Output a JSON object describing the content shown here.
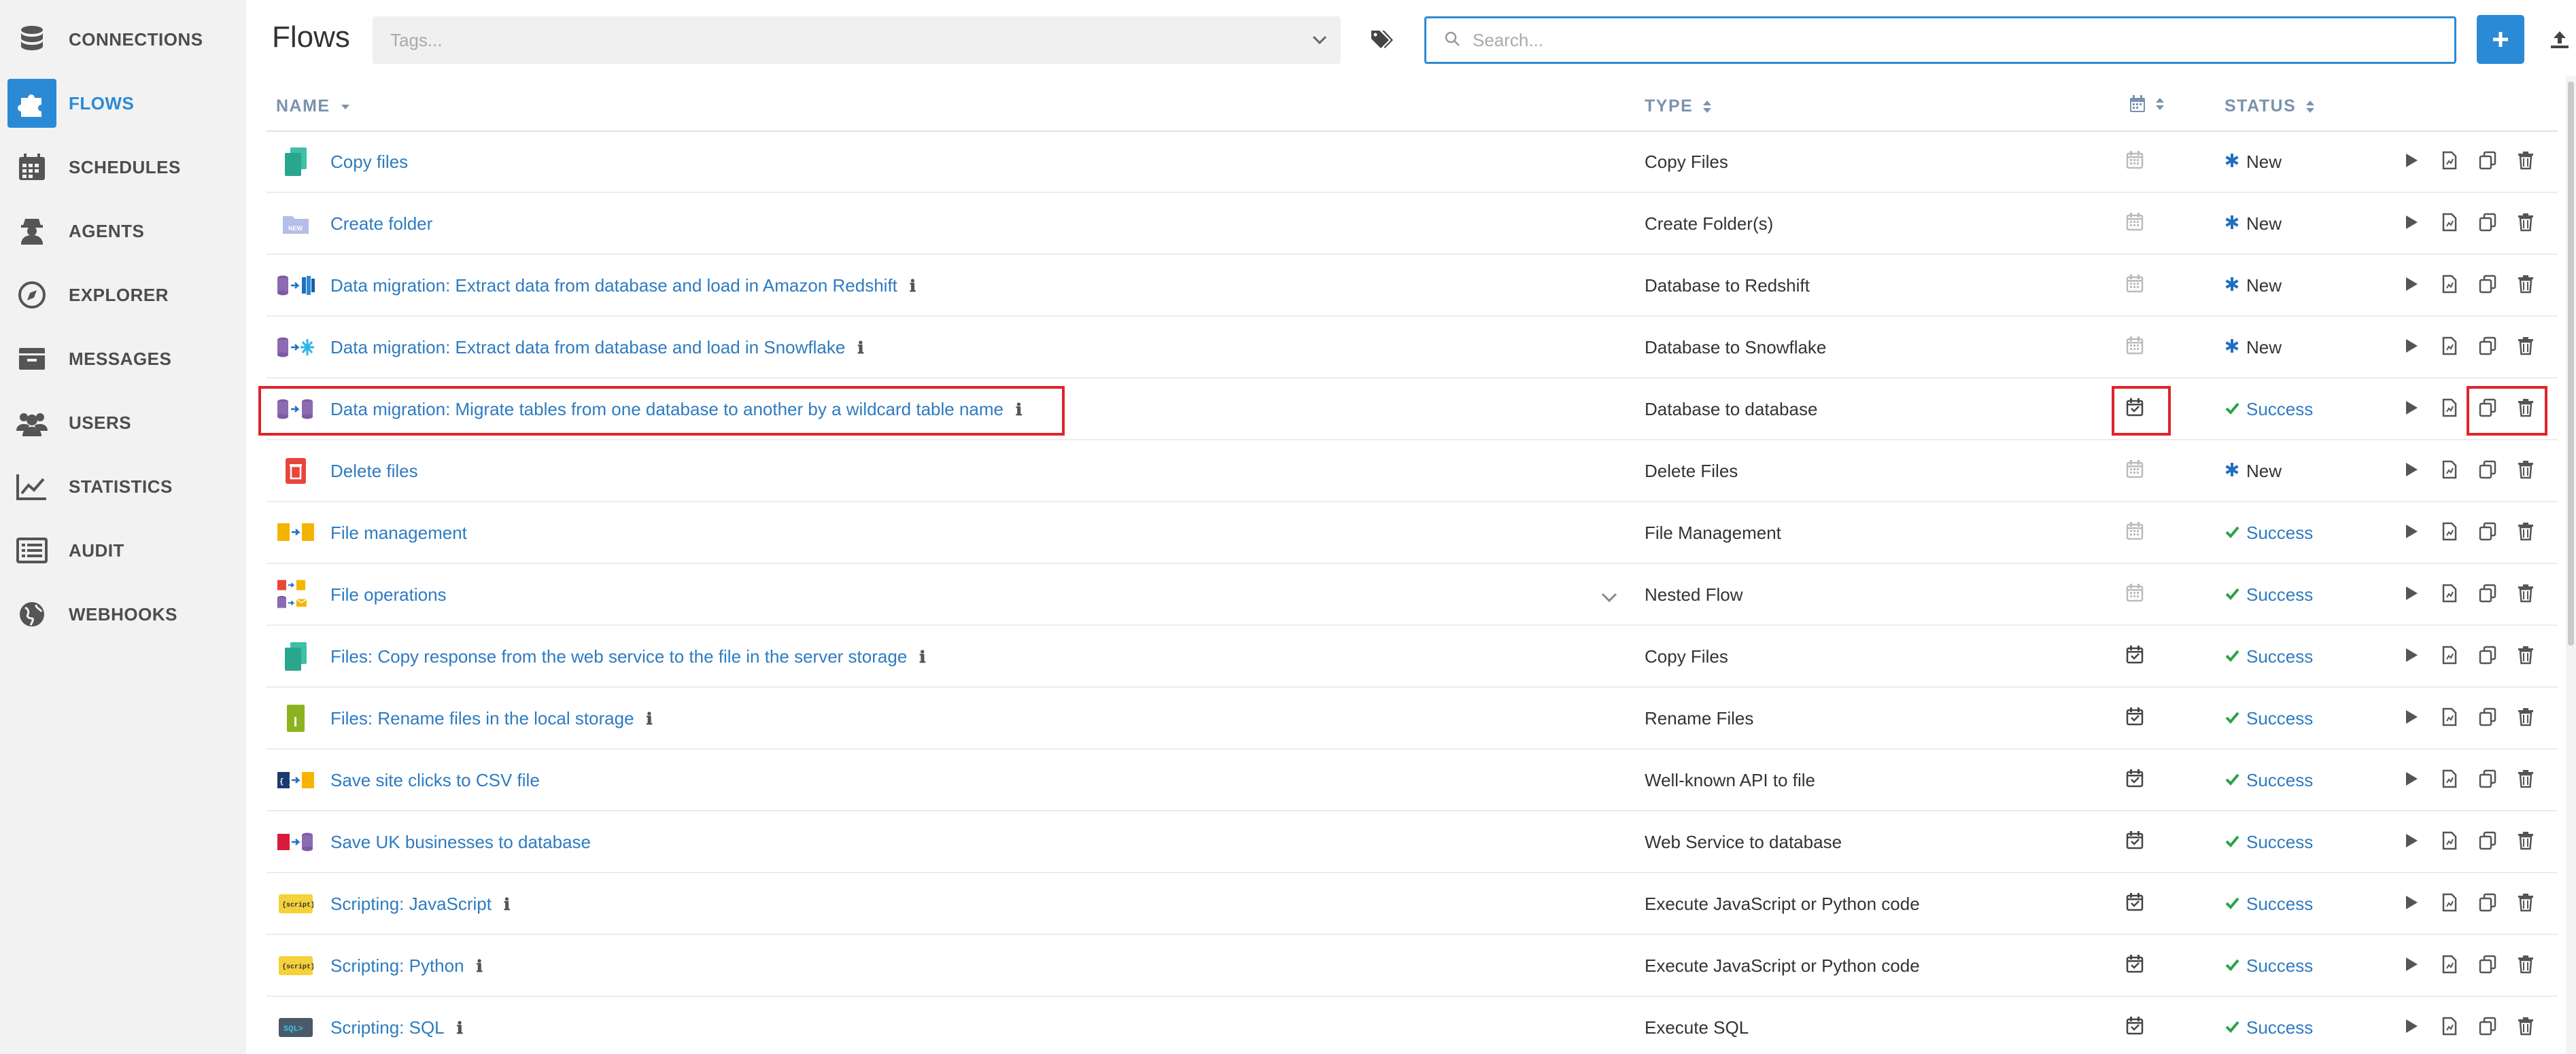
{
  "sidebar": {
    "items": [
      {
        "label": "CONNECTIONS",
        "icon": "database-icon",
        "active": false
      },
      {
        "label": "FLOWS",
        "icon": "puzzle-icon",
        "active": true
      },
      {
        "label": "SCHEDULES",
        "icon": "calendar-icon",
        "active": false
      },
      {
        "label": "AGENTS",
        "icon": "agent-icon",
        "active": false
      },
      {
        "label": "EXPLORER",
        "icon": "compass-icon",
        "active": false
      },
      {
        "label": "MESSAGES",
        "icon": "inbox-icon",
        "active": false
      },
      {
        "label": "USERS",
        "icon": "users-icon",
        "active": false
      },
      {
        "label": "STATISTICS",
        "icon": "chart-line-icon",
        "active": false
      },
      {
        "label": "AUDIT",
        "icon": "list-icon",
        "active": false
      },
      {
        "label": "WEBHOOKS",
        "icon": "globe-icon",
        "active": false
      }
    ]
  },
  "header": {
    "title": "Flows",
    "tags_placeholder": "Tags...",
    "search_placeholder": "Search..."
  },
  "table": {
    "columns": {
      "name": "NAME",
      "type": "TYPE",
      "status": "STATUS"
    },
    "rows": [
      {
        "name": "Copy files",
        "info": false,
        "type": "Copy Files",
        "status": "New",
        "scheduled": false,
        "icon": "copy-files-icon"
      },
      {
        "name": "Create folder",
        "info": false,
        "type": "Create Folder(s)",
        "status": "New",
        "scheduled": false,
        "icon": "new-folder-icon"
      },
      {
        "name": "Data migration: Extract data from database and load in Amazon Redshift",
        "info": true,
        "type": "Database to Redshift",
        "status": "New",
        "scheduled": false,
        "icon": "db-to-redshift-icon"
      },
      {
        "name": "Data migration: Extract data from database and load in Snowflake",
        "info": true,
        "type": "Database to Snowflake",
        "status": "New",
        "scheduled": false,
        "icon": "db-to-snowflake-icon"
      },
      {
        "name": "Data migration: Migrate tables from one database to another by a wildcard table name",
        "info": true,
        "type": "Database to database",
        "status": "Success",
        "scheduled": true,
        "icon": "db-to-db-icon"
      },
      {
        "name": "Delete files",
        "info": false,
        "type": "Delete Files",
        "status": "New",
        "scheduled": false,
        "icon": "delete-files-icon"
      },
      {
        "name": "File management",
        "info": false,
        "type": "File Management",
        "status": "Success",
        "scheduled": false,
        "icon": "file-management-icon"
      },
      {
        "name": "File operations",
        "info": false,
        "type": "Nested Flow",
        "status": "Success",
        "scheduled": false,
        "icon": "nested-flow-icon"
      },
      {
        "name": "Files: Copy response from the web service to the file in the server storage",
        "info": true,
        "type": "Copy Files",
        "status": "Success",
        "scheduled": true,
        "icon": "copy-files-icon"
      },
      {
        "name": "Files: Rename files in the local storage",
        "info": true,
        "type": "Rename Files",
        "status": "Success",
        "scheduled": true,
        "icon": "rename-files-icon"
      },
      {
        "name": "Save site clicks to CSV file",
        "info": false,
        "type": "Well-known API to file",
        "status": "Success",
        "scheduled": true,
        "icon": "api-to-file-icon"
      },
      {
        "name": "Save UK businesses to database",
        "info": false,
        "type": "Web Service to database",
        "status": "Success",
        "scheduled": true,
        "icon": "web-to-db-icon"
      },
      {
        "name": "Scripting: JavaScript",
        "info": true,
        "type": "Execute JavaScript or Python code",
        "status": "Success",
        "scheduled": true,
        "icon": "script-icon"
      },
      {
        "name": "Scripting: Python",
        "info": true,
        "type": "Execute JavaScript or Python code",
        "status": "Success",
        "scheduled": true,
        "icon": "script-icon"
      },
      {
        "name": "Scripting: SQL",
        "info": true,
        "type": "Execute SQL",
        "status": "Success",
        "scheduled": true,
        "icon": "sql-script-icon"
      }
    ]
  },
  "colors": {
    "accent": "#2b8ad6",
    "link": "#2e7bc0",
    "success": "#2aa24a",
    "highlight": "#e0232b"
  }
}
